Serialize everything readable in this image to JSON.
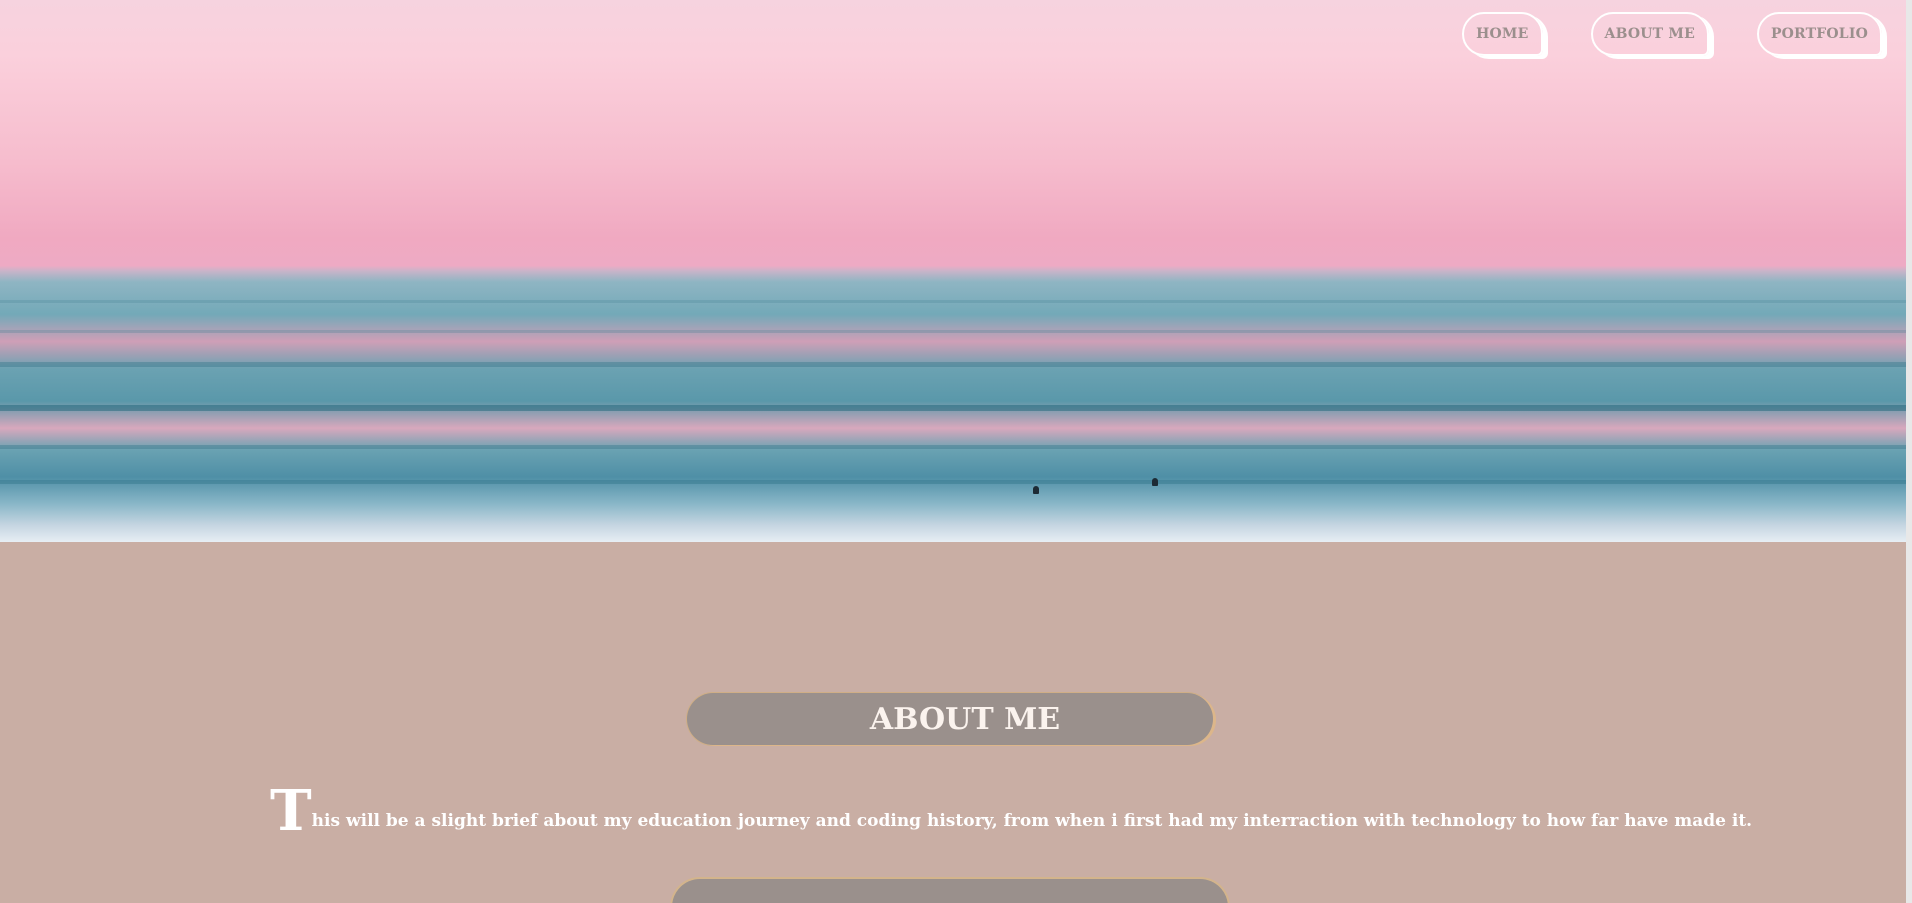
{
  "nav": {
    "items": [
      {
        "label": "HOME"
      },
      {
        "label": "ABOUT ME"
      },
      {
        "label": "PORTFOLIO"
      }
    ]
  },
  "about": {
    "heading": "ABOUT ME",
    "intro_dropcap": "T",
    "intro_text": "his will be a slight brief about my education journey and coding history, from when i first had my interraction with technology to how far have made it."
  },
  "colors": {
    "section_background": "#c9aea4",
    "pill_background": "#9a908c",
    "pill_border": "#d3b48c",
    "nav_text": "#9b8f8d",
    "text_light": "#ffffff"
  }
}
